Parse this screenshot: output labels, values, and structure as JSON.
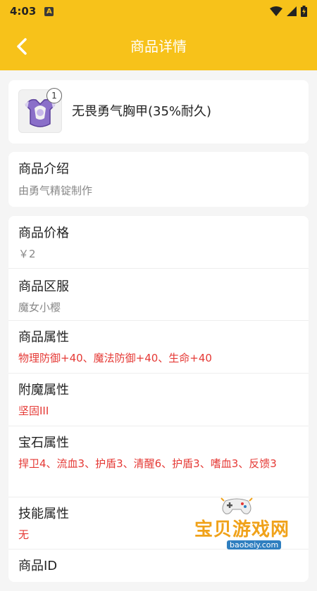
{
  "status_bar": {
    "time": "4:03",
    "notification_badge": "A"
  },
  "navbar": {
    "title": "商品详情"
  },
  "product": {
    "quantity": "1",
    "name": "无畏勇气胸甲(35%耐久)"
  },
  "intro": {
    "label": "商品介绍",
    "value": "由勇气精锭制作"
  },
  "details": [
    {
      "label": "商品价格",
      "value": "￥2"
    },
    {
      "label": "商品区服",
      "value": "魔女小樱"
    },
    {
      "label": "商品属性",
      "value": "物理防御+40、魔法防御+40、生命+40"
    },
    {
      "label": "附魔属性",
      "value": "坚固III"
    },
    {
      "label": "宝石属性",
      "value": "捍卫4、流血3、护盾3、清醒6、护盾3、嗜血3、反馈3"
    },
    {
      "label": "技能属性",
      "value": "无"
    },
    {
      "label": "商品ID",
      "value": ""
    }
  ],
  "watermark": {
    "text": "宝贝游戏网",
    "url": "baobeiy.com"
  },
  "colors": {
    "brand_yellow": "#f7c21a",
    "highlight_red": "#e53935"
  }
}
